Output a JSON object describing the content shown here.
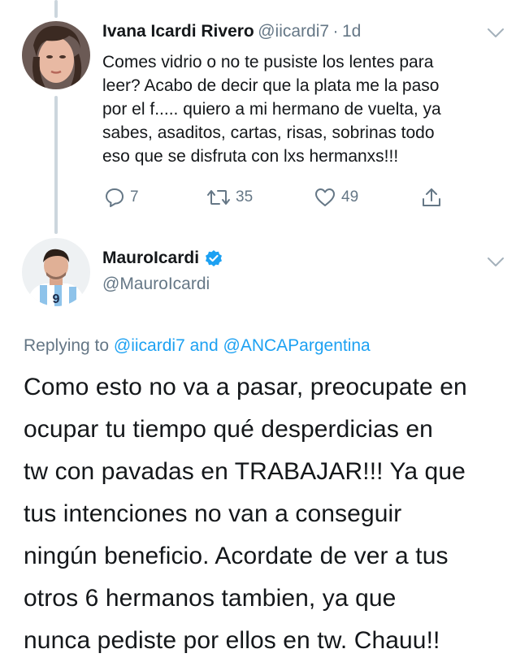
{
  "reply_tweet": {
    "display_name": "Ivana Icardi Rivero",
    "handle": "@iicardi7",
    "separator": "·",
    "time": "1d",
    "text_lines": [
      "Comes vidrio o no te pusiste los lentes para",
      "leer? Acabo de decir que la plata me la paso",
      "por el f..... quiero a mi hermano de vuelta, ya",
      "sabes, asaditos, cartas, risas, sobrinas todo",
      "eso que se disfruta con lxs hermanxs!!!"
    ],
    "actions": {
      "replies": "7",
      "retweets": "35",
      "likes": "49"
    },
    "icons": {
      "reply": "comment-icon",
      "retweet": "retweet-icon",
      "like": "heart-icon",
      "share": "share-icon",
      "menu": "chevron-down-icon"
    }
  },
  "main_tweet": {
    "display_name": "MauroIcardi",
    "handle": "@MauroIcardi",
    "verified": true,
    "replying_to_prefix": "Replying to",
    "replying_to_user1": "@iicardi7",
    "replying_to_and": "and",
    "replying_to_user2": "@ANCAPargentina",
    "text_lines": [
      "Como esto no va a pasar, preocupate en",
      "ocupar tu tiempo qué desperdicias en",
      "tw con pavadas en TRABAJAR!!! Ya que",
      "tus intenciones no van a conseguir",
      "ningún beneficio. Acordate de ver a tus",
      "otros 6 hermanos tambien, ya que",
      "nunca pediste por ellos en tw. Chauu!!"
    ]
  },
  "colors": {
    "text": "#14171a",
    "secondary": "#657786",
    "link": "#1da1f2",
    "thread_line": "#ccd6dd"
  }
}
